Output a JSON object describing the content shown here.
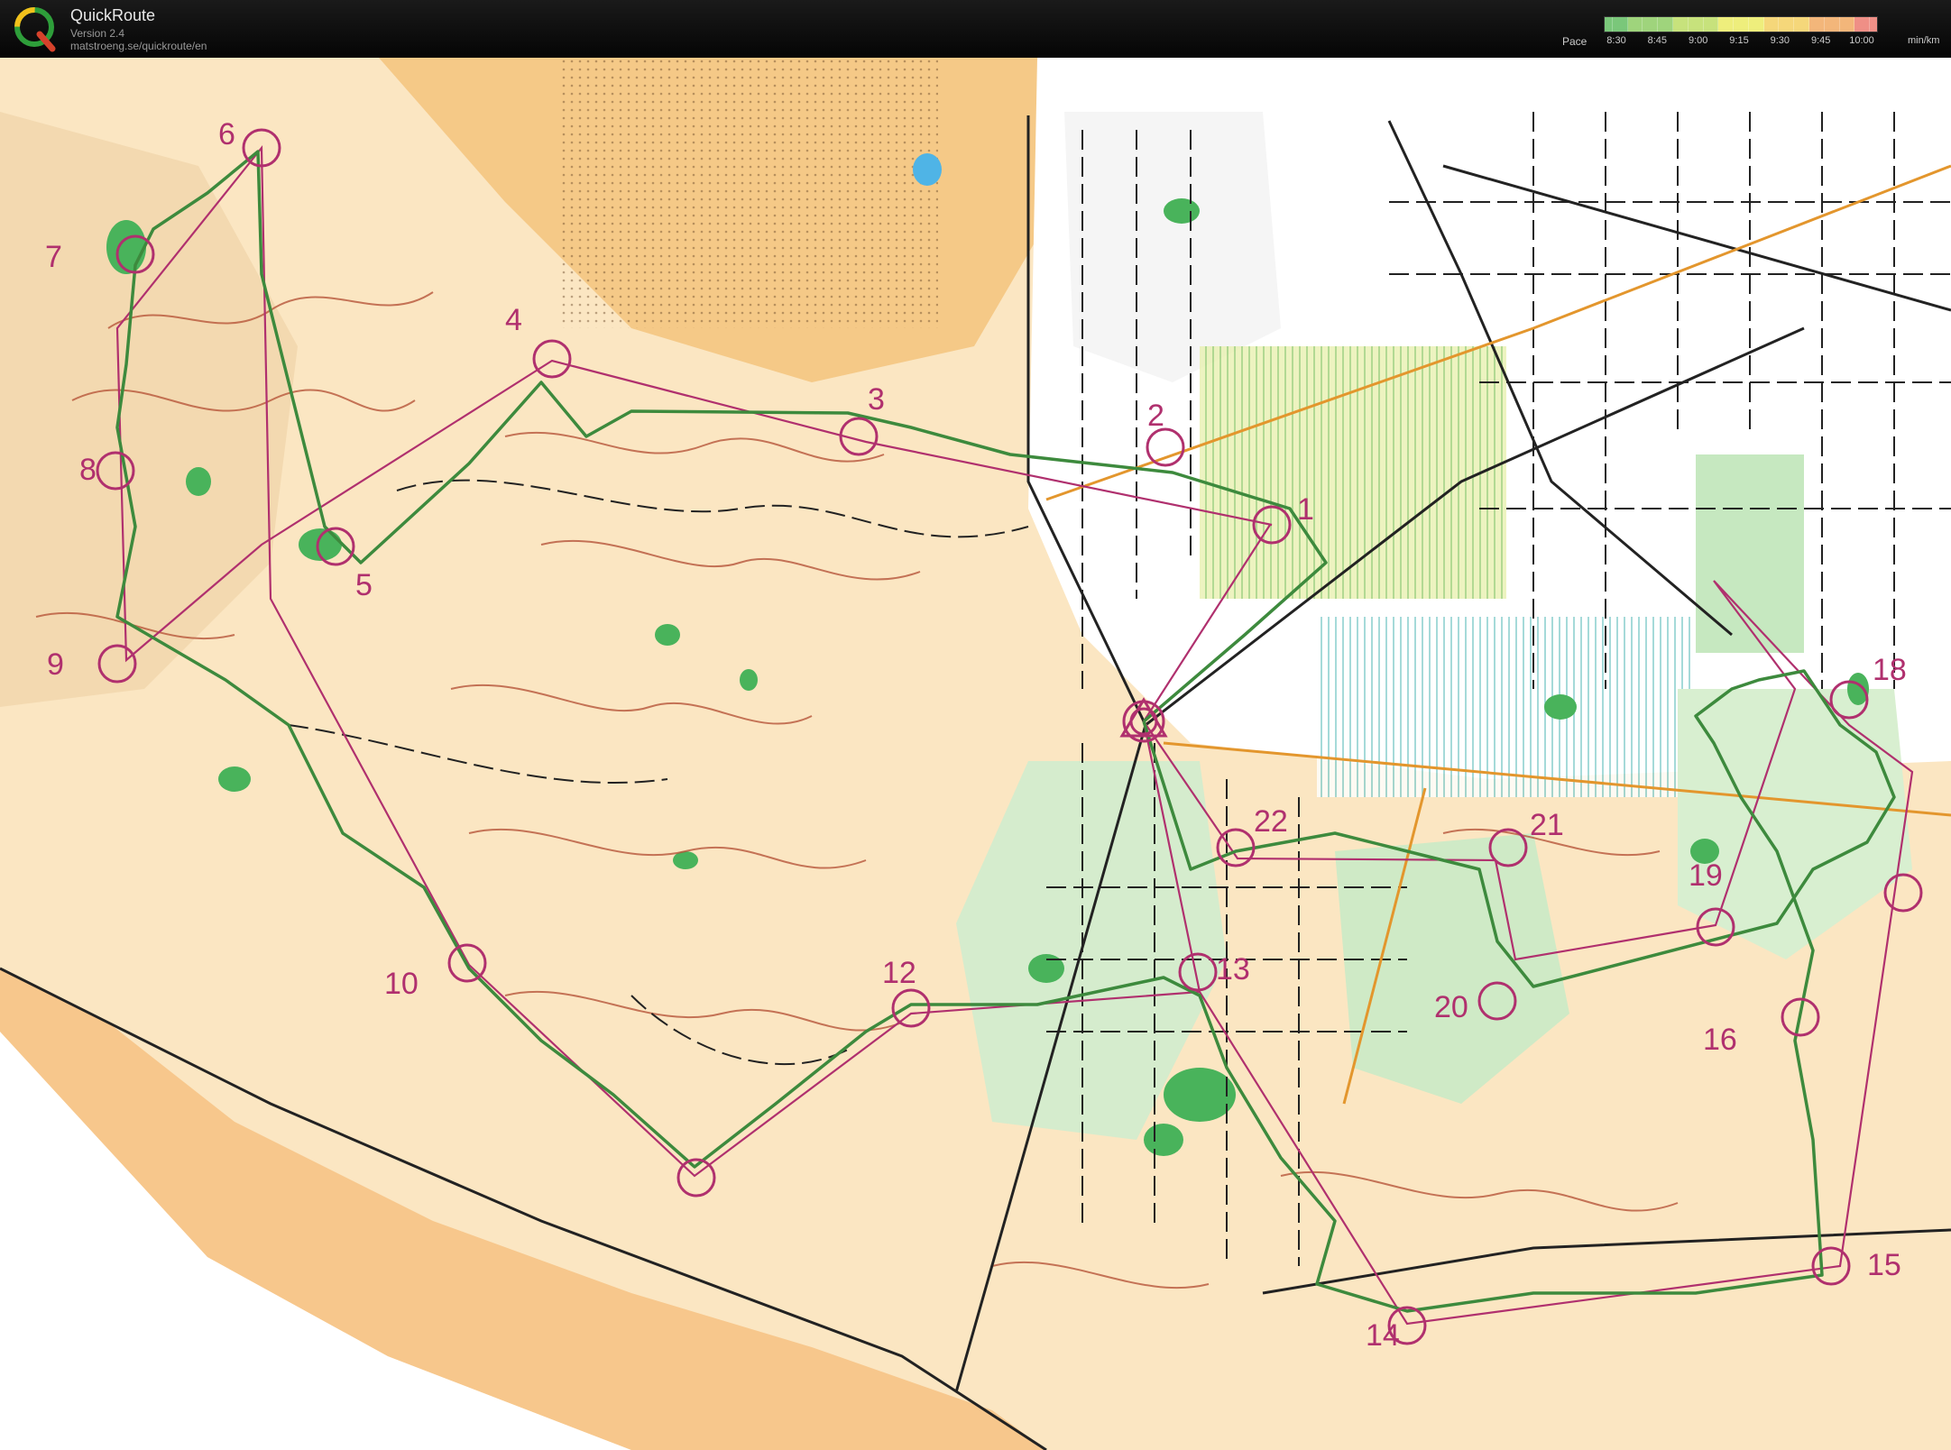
{
  "app": {
    "name": "QuickRoute",
    "version": "Version 2.4",
    "url": "matstroeng.se/quickroute/en"
  },
  "pace_legend": {
    "label": "Pace",
    "ticks": [
      "8:30",
      "8:45",
      "9:00",
      "9:15",
      "9:30",
      "9:45",
      "10:00"
    ],
    "unit": "min/km",
    "gradient_colors": [
      "#7ac77a",
      "#9fd47c",
      "#c7e27c",
      "#eeee7c",
      "#f5d77a",
      "#f3b67a",
      "#ef8f86"
    ]
  },
  "map": {
    "control_labels": [
      "1",
      "2",
      "3",
      "4",
      "5",
      "6",
      "7",
      "8",
      "9",
      "10",
      "12",
      "13",
      "14",
      "15",
      "16",
      "18",
      "19",
      "20",
      "21",
      "22"
    ],
    "colors": {
      "course": "#b0306e",
      "route": "#3d8a3d",
      "open_land": "#f5c98a",
      "rough_open": "#fae3b6",
      "forest": "#ffffff",
      "vegetation": "#49b35b",
      "contour": "#b6553a"
    }
  }
}
